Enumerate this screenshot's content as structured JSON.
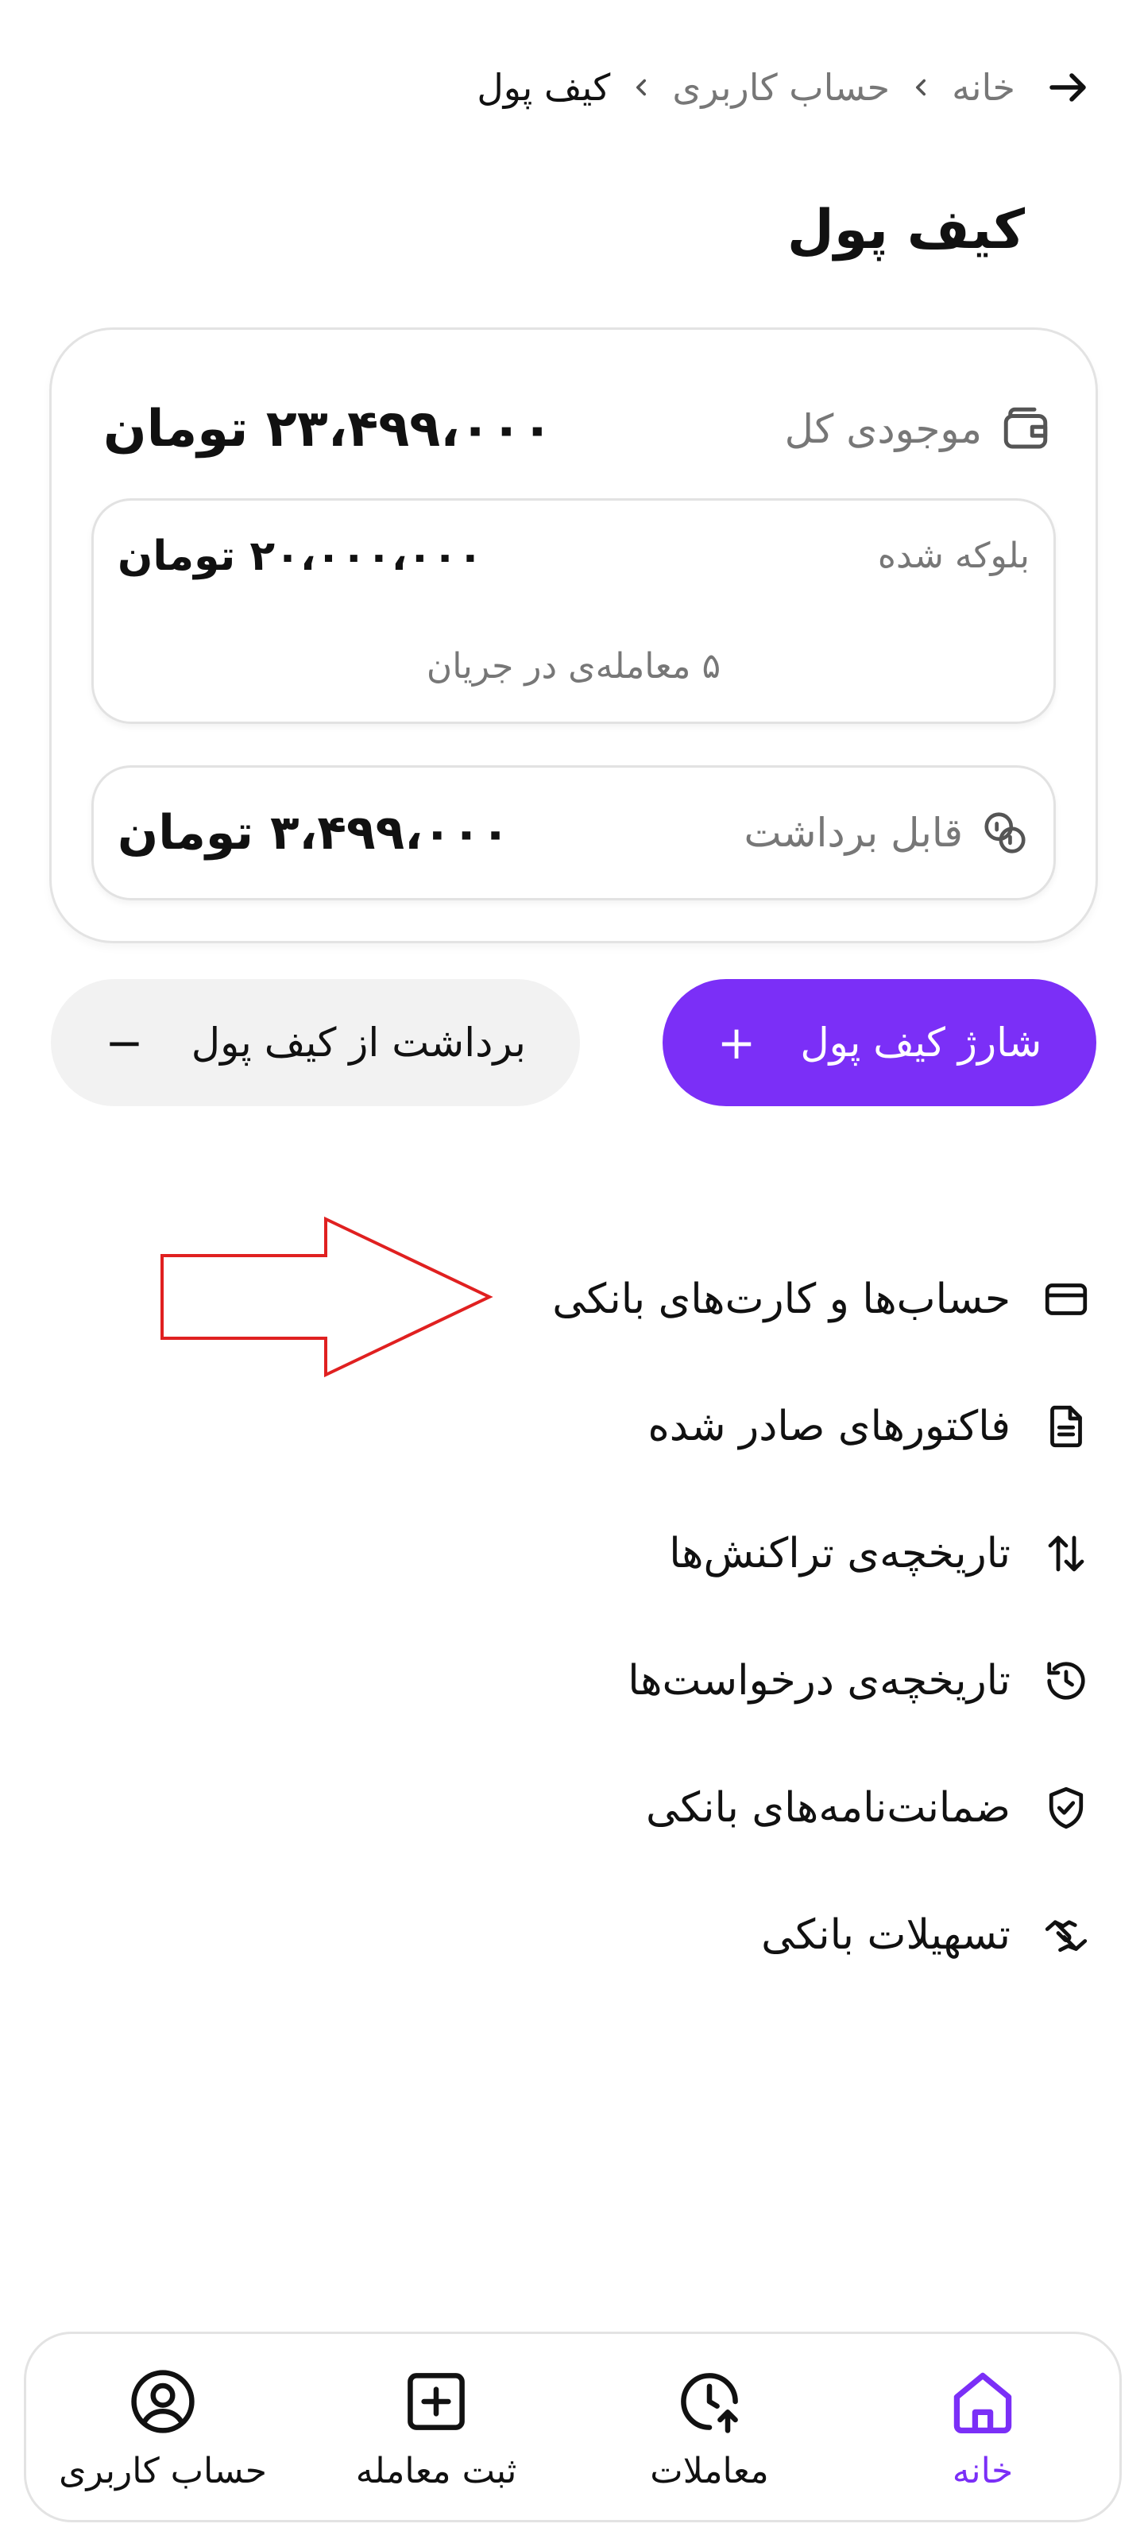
{
  "header": {
    "breadcrumb": [
      "خانه",
      "حساب کاربری",
      "کیف پول"
    ],
    "page_title": "کیف پول"
  },
  "wallet": {
    "total_label": "موجودی کل",
    "total_amount": "۲۳،۴۹۹،۰۰۰ تومان",
    "blocked_label": "بلوکه شده",
    "blocked_amount": "۲۰،۰۰۰،۰۰۰ تومان",
    "blocked_sub": "۵ معامله‌ی در جریان",
    "withdrawable_label": "قابل برداشت",
    "withdrawable_amount": "۳،۴۹۹،۰۰۰ تومان"
  },
  "actions": {
    "charge_label": "شارژ کیف پول",
    "charge_symbol": "+",
    "withdraw_label": "برداشت از کیف پول",
    "withdraw_symbol": "−"
  },
  "menu": [
    {
      "label": "حساب‌ها و کارت‌های بانکی",
      "icon": "credit-card-icon"
    },
    {
      "label": "فاکتورهای صادر شده",
      "icon": "document-icon"
    },
    {
      "label": "تاریخچه‌ی تراکنش‌ها",
      "icon": "swap-arrows-icon"
    },
    {
      "label": "تاریخچه‌ی درخواست‌ها",
      "icon": "history-icon"
    },
    {
      "label": "ضمانت‌نامه‌های بانکی",
      "icon": "shield-check-icon"
    },
    {
      "label": "تسهیلات بانکی",
      "icon": "handshake-icon"
    }
  ],
  "bottom_nav": [
    {
      "label": "خانه",
      "icon": "home-icon",
      "active": true
    },
    {
      "label": "معاملات",
      "icon": "clock-upload-icon",
      "active": false
    },
    {
      "label": "ثبت معامله",
      "icon": "add-square-icon",
      "active": false
    },
    {
      "label": "حساب کاربری",
      "icon": "user-circle-icon",
      "active": false
    }
  ],
  "colors": {
    "accent": "#7b2ff7",
    "annotation": "#e02020"
  }
}
